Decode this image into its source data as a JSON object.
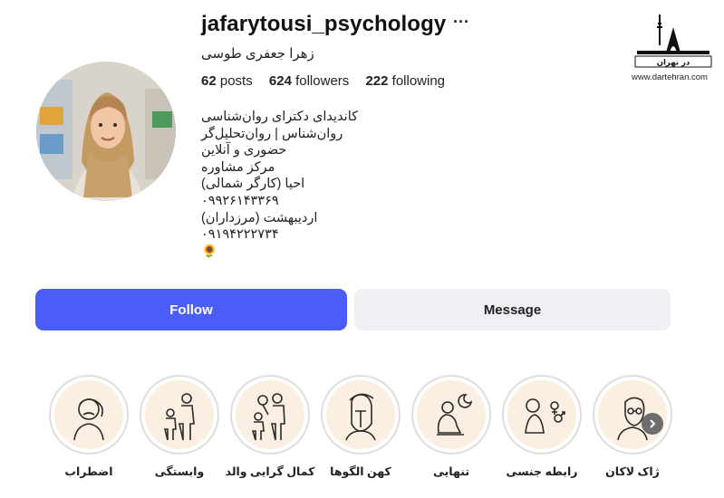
{
  "profile": {
    "username": "jafarytousi_psychology",
    "more_icon": "···",
    "full_name": "زهرا جعفری طوسی",
    "stats": {
      "posts_count": "62",
      "posts_label": "posts",
      "followers_count": "624",
      "followers_label": "followers",
      "following_count": "222",
      "following_label": "following"
    },
    "bio": [
      "کاندیدای دکترای روان‌شناسی",
      "روان‌شناس | روان‌تحلیل‌گر",
      "حضوری و آنلاین",
      "مرکز مشاوره",
      "احیا (کارگر شمالی)",
      "۰۹۹۲۶۱۴۳۳۶۹",
      "اردیبهشت (مرزداران)",
      "۰۹۱۹۴۲۲۲۷۳۴",
      "🌻"
    ]
  },
  "actions": {
    "follow_label": "Follow",
    "message_label": "Message"
  },
  "highlights": [
    {
      "label": "اضطراب",
      "icon": "anxious-person-icon"
    },
    {
      "label": "وابستگی",
      "icon": "adult-child-icon"
    },
    {
      "label": "کمال گرایی والد",
      "icon": "parent-child-balloon-icon"
    },
    {
      "label": "کهن الگوها",
      "icon": "spartan-helmet-icon"
    },
    {
      "label": "تنهایی",
      "icon": "lonely-person-moon-icon"
    },
    {
      "label": "رابطه جنسی",
      "icon": "gender-symbols-icon"
    },
    {
      "label": "ژاک لاکان",
      "icon": "lacan-portrait-icon"
    }
  ],
  "watermark": {
    "logo_text": "در تهران",
    "url": "www.dartehran.com"
  },
  "colors": {
    "follow_bg": "#4a5df9",
    "message_bg": "#eef0f3",
    "highlight_bg": "#fbefe2"
  }
}
